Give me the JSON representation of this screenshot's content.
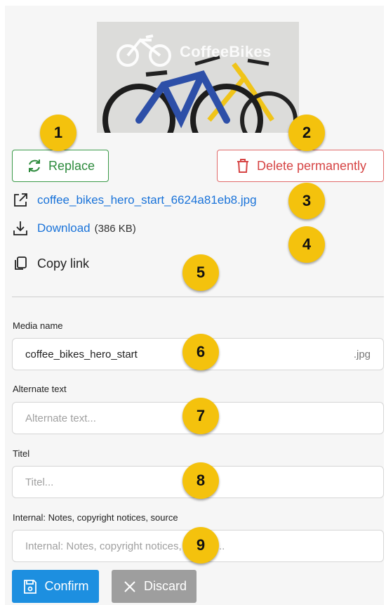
{
  "preview": {
    "brand_text": "CoffeeBikes"
  },
  "actions": {
    "replace_label": "Replace",
    "delete_label": "Delete permanently"
  },
  "file": {
    "name": "coffee_bikes_hero_start_6624a81eb8.jpg",
    "download_label": "Download",
    "download_size": "(386 KB)",
    "copy_label": "Copy link"
  },
  "form": {
    "media_name_label": "Media name",
    "media_name_value": "coffee_bikes_hero_start",
    "media_name_suffix": ".jpg",
    "alt_label": "Alternate text",
    "alt_placeholder": "Alternate text...",
    "title_label": "Titel",
    "title_placeholder": "Titel...",
    "notes_label": "Internal: Notes, copyright notices, source",
    "notes_placeholder": "Internal: Notes, copyright notices, source..."
  },
  "footer": {
    "confirm_label": "Confirm",
    "discard_label": "Discard"
  },
  "badges": [
    "1",
    "2",
    "3",
    "4",
    "5",
    "6",
    "7",
    "8",
    "9"
  ],
  "colors": {
    "accent": "#1d8fe0",
    "danger": "#d64545",
    "success": "#2e8b3d",
    "badge": "#f4c20d"
  }
}
